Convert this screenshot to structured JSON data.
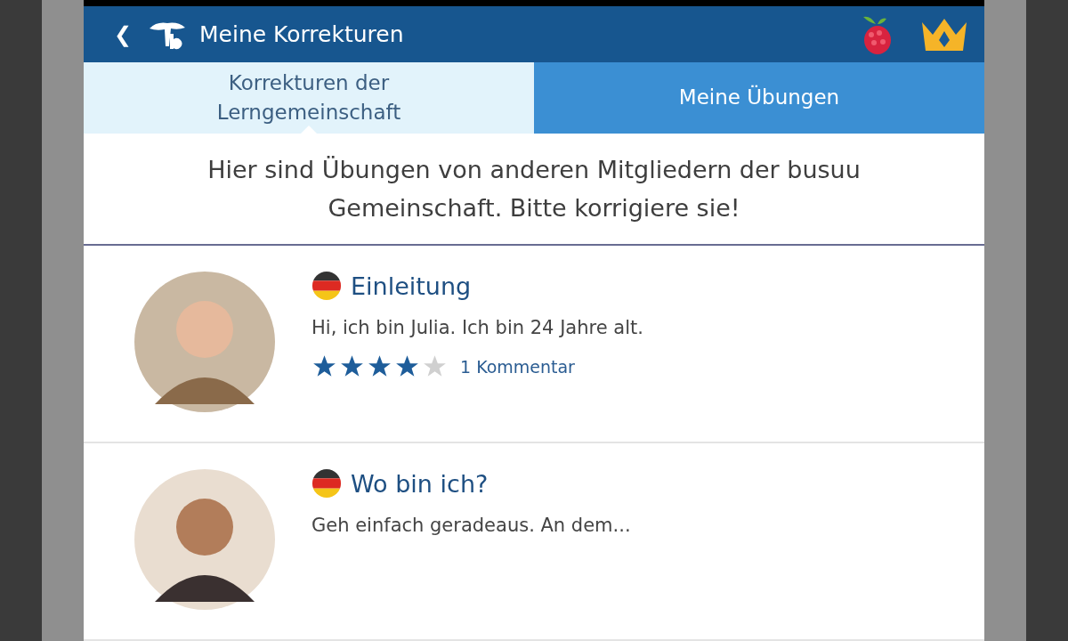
{
  "app_bar": {
    "back": "❮",
    "title": "Meine Korrekturen"
  },
  "tabs": [
    {
      "label": "Korrekturen der Lerngemeinschaft",
      "selected": true
    },
    {
      "label": "Meine Übungen",
      "selected": false
    }
  ],
  "intro": "Hier sind Übungen von anderen Mitgliedern der busuu Gemeinschaft. Bitte korrigiere sie!",
  "exercises": [
    {
      "title": "Einleitung",
      "text": "Hi, ich bin Julia. Ich bin 24 Jahre alt.",
      "stars": 4,
      "comments": "1 Kommentar"
    },
    {
      "title": "Wo bin ich?",
      "text": "Geh einfach geradeaus. An dem..."
    }
  ]
}
